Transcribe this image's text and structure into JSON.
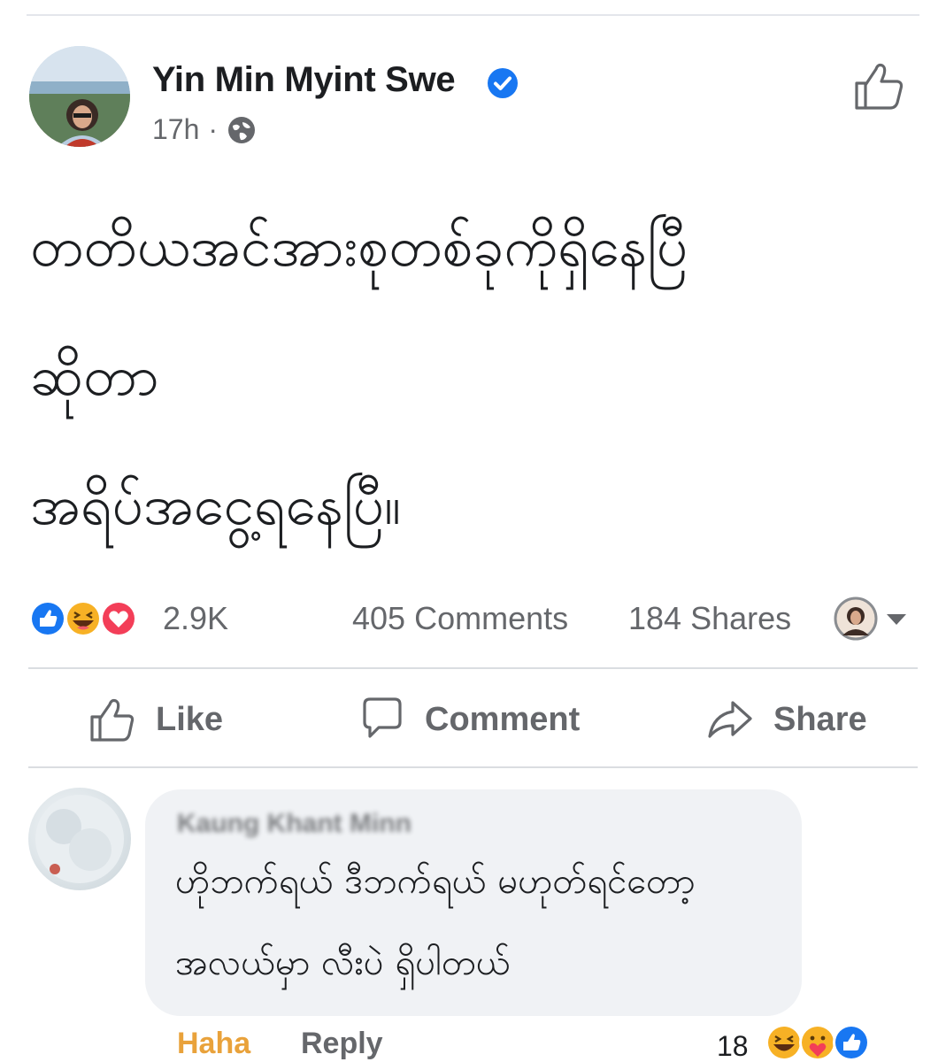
{
  "post": {
    "author": "Yin Min Myint Swe",
    "time": "17h",
    "separator": "·",
    "privacy_icon": "globe-icon",
    "text_lines": [
      "တတိယအင်အားစုတစ်ခုကိုရှိနေပြီ",
      "ဆိုတာ",
      "အရိပ်အငွေ့ရနေပြီ။"
    ]
  },
  "stats": {
    "reaction_icons": [
      "like",
      "haha",
      "love"
    ],
    "reactions_count": "2.9K",
    "comments": "405 Comments",
    "shares": "184 Shares"
  },
  "actions": {
    "like": "Like",
    "comment": "Comment",
    "share": "Share"
  },
  "comment": {
    "author": "Kaung Khant Minn",
    "text_lines": [
      "ဟိုဘက်ရယ် ဒီဘက်ရယ် မဟုတ်ရင်တော့",
      "အလယ်မှာ လီးပဲ ရှိပါတယ်"
    ],
    "haha_label": "Haha",
    "reply_label": "Reply",
    "reactions_count": "18",
    "reaction_icons": [
      "haha",
      "care",
      "like"
    ]
  },
  "colors": {
    "facebook_blue": "#1877f2",
    "love_red": "#f33e58",
    "haha_yellow": "#f7b125",
    "muted_text": "#65676b",
    "bubble_bg": "#f0f2f5"
  }
}
